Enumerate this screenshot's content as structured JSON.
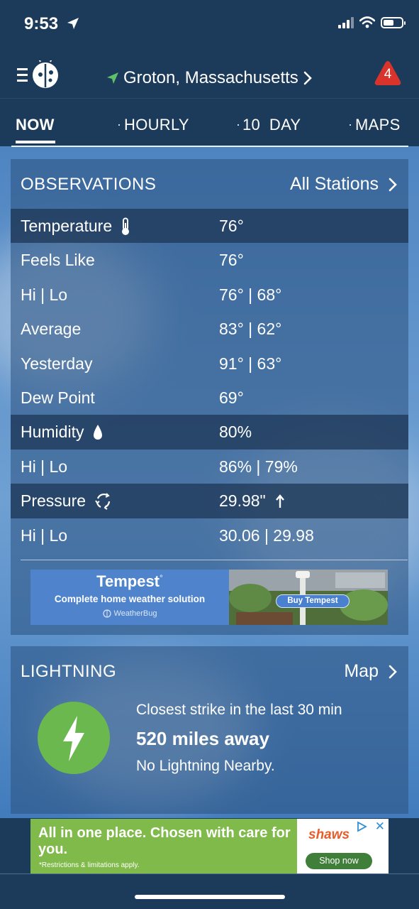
{
  "status_bar": {
    "time": "9:53",
    "battery_level": 0.6
  },
  "header": {
    "location": "Groton,  Massachusetts",
    "alert_count": "4",
    "colors": {
      "bar": "#1c3a59",
      "location_arrow": "#5fc06a",
      "alert": "#d9342b"
    }
  },
  "tabs": [
    {
      "label": "NOW",
      "active": true
    },
    {
      "label": "HOURLY",
      "active": false
    },
    {
      "label": "10  DAY",
      "active": false
    },
    {
      "label": "MAPS",
      "active": false
    }
  ],
  "observations": {
    "title": "OBSERVATIONS",
    "link_label": "All Stations",
    "rows": [
      {
        "label": "Temperature",
        "value": "76°",
        "icon": "thermometer-icon"
      },
      {
        "label": "Feels Like",
        "value": "76°"
      },
      {
        "label": "Hi | Lo",
        "value": "76° | 68°"
      },
      {
        "label": "Average",
        "value": "83° | 62°"
      },
      {
        "label": "Yesterday",
        "value": "91° | 63°"
      },
      {
        "label": "Dew Point",
        "value": "69°"
      },
      {
        "label": "Humidity",
        "value": "80%",
        "icon": "water-drop-icon"
      },
      {
        "label": "Hi | Lo",
        "value": "86% | 79%"
      },
      {
        "label": "Pressure",
        "value": "29.98\"",
        "icon": "pressure-cycle-icon",
        "trend": "arrow-up-icon"
      },
      {
        "label": "Hi | Lo",
        "value": "30.06 | 29.98"
      }
    ]
  },
  "tempest_ad": {
    "logo": "Tempest",
    "tagline": "Complete home weather solution",
    "brand": "WeatherBug",
    "button": "Buy Tempest"
  },
  "lightning": {
    "title": "LIGHTNING",
    "link_label": "Map",
    "caption": "Closest strike in the last 30 min",
    "distance": "520 miles away",
    "status": "No Lightning Nearby.",
    "icon_color": "#6bb84f"
  },
  "shaws_ad": {
    "headline": "All in one place. Chosen with care for you.",
    "fine_print": "*Restrictions & limitations apply.",
    "logo": "shaws",
    "button": "Shop now",
    "color": "#7fba4a"
  }
}
